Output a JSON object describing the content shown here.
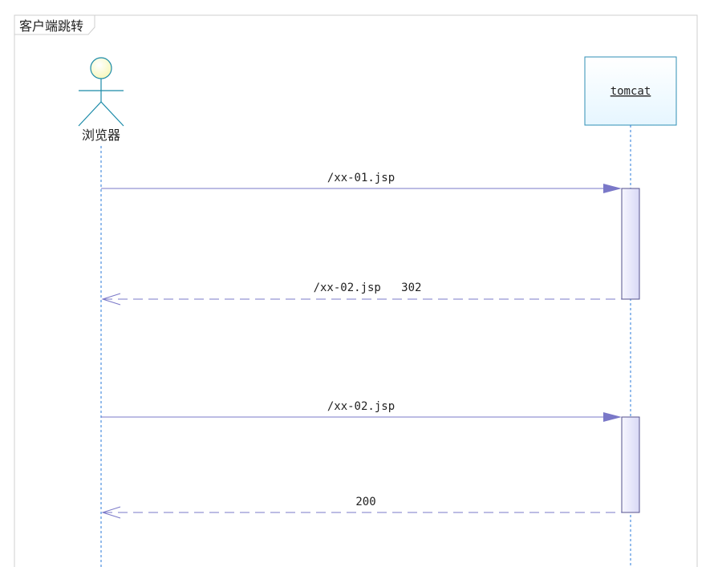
{
  "frame": {
    "title": "客户端跳转"
  },
  "participants": [
    {
      "id": "browser",
      "kind": "actor",
      "label": "浏览器"
    },
    {
      "id": "tomcat",
      "kind": "box",
      "label": "tomcat"
    }
  ],
  "messages": [
    {
      "label": "/xx-01.jsp",
      "from": "browser",
      "to": "tomcat",
      "kind": "request"
    },
    {
      "label": "/xx-02.jsp   302",
      "from": "tomcat",
      "to": "browser",
      "kind": "return"
    },
    {
      "label": "/xx-02.jsp",
      "from": "browser",
      "to": "tomcat",
      "kind": "request"
    },
    {
      "label": "200",
      "from": "tomcat",
      "to": "browser",
      "kind": "return"
    }
  ],
  "colors": {
    "frame_border": "#cfcfcf",
    "lifeline": "#2a7ad8",
    "actor_head_fill": "#ffffcc",
    "actor_stroke": "#1a8aa8",
    "box_border": "#2f8fb4",
    "box_fill": "#eef8ff",
    "message": "#7a78c8",
    "activation_fill": "#e3e3fb",
    "activation_stroke": "#55528e"
  }
}
